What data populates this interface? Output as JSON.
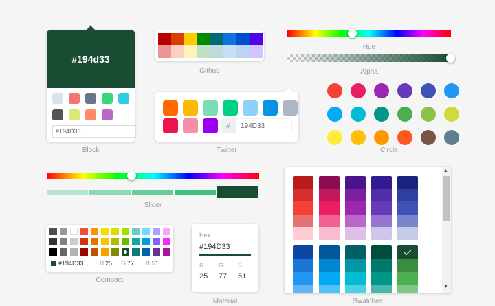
{
  "block": {
    "hex": "#194d33",
    "input_value": "#194D33",
    "caption": "Block",
    "swatches": [
      "#d9e3f0",
      "#f47373",
      "#697689",
      "#37d67a",
      "#2ccce4",
      "#555555",
      "#dce775",
      "#ff8a65",
      "#ba68c8"
    ]
  },
  "github": {
    "caption": "Github",
    "swatches": [
      "#b80000",
      "#db3e00",
      "#fccb00",
      "#008b02",
      "#006b76",
      "#1273de",
      "#004dcf",
      "#5300eb",
      "#eb9694",
      "#fad0c3",
      "#fef3bd",
      "#c1e1c5",
      "#bedadc",
      "#c4def6",
      "#bed3f3",
      "#d4c4fb"
    ]
  },
  "twitter": {
    "caption": "Twitter",
    "hash": "#",
    "input_value": "194D33",
    "swatches": [
      "#ff6900",
      "#fcb900",
      "#7bdcb5",
      "#00d084",
      "#8ed1fc",
      "#0693e3",
      "#abb8c3",
      "#eb144c",
      "#f78da7",
      "#9900ef"
    ]
  },
  "hue": {
    "caption": "Hue",
    "value": 0.4
  },
  "alpha": {
    "caption": "Alpha",
    "value": 1.0
  },
  "circle": {
    "caption": "Circle",
    "swatches": [
      "#f44336",
      "#e91e63",
      "#9c27b0",
      "#673ab7",
      "#3f51b5",
      "#2196f3",
      "#03a9f4",
      "#00bcd4",
      "#009688",
      "#4caf50",
      "#8bc34a",
      "#cddc39",
      "#ffeb3b",
      "#ffc107",
      "#ff9800",
      "#ff5722",
      "#795548",
      "#607d8b"
    ]
  },
  "slider": {
    "caption": "Slider",
    "value": 0.4,
    "swatches": [
      "#b3e6cd",
      "#8cd9b3",
      "#66cc99",
      "#40bf80",
      "#194d33"
    ]
  },
  "compact": {
    "caption": "Compact",
    "swatches": [
      "#4d4d4d",
      "#999999",
      "#ffffff",
      "#f44e3b",
      "#fe9200",
      "#fcdc00",
      "#dbdf00",
      "#a4dd00",
      "#68ccca",
      "#73d8ff",
      "#aea1ff",
      "#fda1ff",
      "#333333",
      "#808080",
      "#cccccc",
      "#d33115",
      "#e27300",
      "#fcc400",
      "#b0bc00",
      "#68bc00",
      "#16a5a5",
      "#009ce0",
      "#7b64ff",
      "#fa28ff",
      "#000000",
      "#666666",
      "#b3b3b3",
      "#9f0500",
      "#c45100",
      "#fb9e00",
      "#808900",
      "#194d33",
      "#0c797d",
      "#0062b1",
      "#653294",
      "#ab149e"
    ],
    "hex_value": "#194D33",
    "r_label": "R",
    "r_value": "25",
    "g_label": "G",
    "g_value": "77",
    "b_label": "B",
    "b_value": "51"
  },
  "material": {
    "caption": "Material",
    "hex_label": "Hex",
    "hex_value": "#194D33",
    "r_label": "R",
    "r_value": "25",
    "g_label": "G",
    "g_value": "77",
    "b_label": "B",
    "b_value": "51"
  },
  "swatches": {
    "caption": "Swatches",
    "groups_top": [
      [
        "#b71c1c",
        "#d32f2f",
        "#f44336",
        "#e57373",
        "#ffcdd2"
      ],
      [
        "#880e4f",
        "#c2185b",
        "#e91e63",
        "#f06292",
        "#f8bbd0"
      ],
      [
        "#4a148c",
        "#7b1fa2",
        "#9c27b0",
        "#ba68c8",
        "#e1bee7"
      ],
      [
        "#311b92",
        "#512da8",
        "#673ab7",
        "#9575cd",
        "#d1c4e9"
      ],
      [
        "#1a237e",
        "#303f9f",
        "#3f51b5",
        "#7986cb",
        "#c5cae9"
      ]
    ],
    "groups_bottom": [
      [
        "#0d47a1",
        "#1976d2",
        "#2196f3",
        "#64b5f6"
      ],
      [
        "#01579b",
        "#0288d1",
        "#03a9f4",
        "#4fc3f7"
      ],
      [
        "#006064",
        "#0097a7",
        "#00bcd4",
        "#4dd0e1"
      ],
      [
        "#004d40",
        "#00796b",
        "#009688",
        "#4db6ac"
      ],
      [
        "#194d33",
        "#388e3c",
        "#4caf50",
        "#81c784"
      ]
    ],
    "selected": "#194d33"
  },
  "scroll": {
    "up_arrow": "▲",
    "down_arrow": "▼"
  }
}
